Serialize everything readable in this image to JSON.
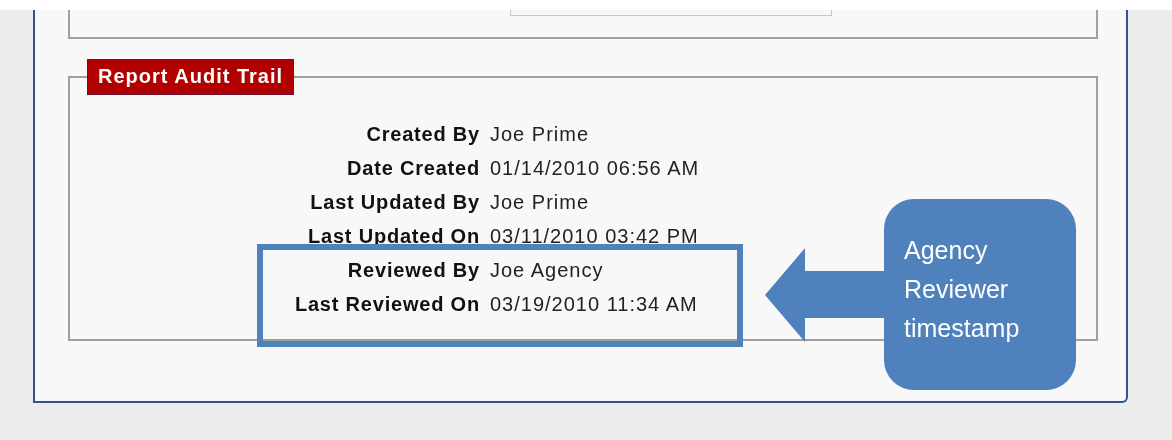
{
  "audit_trail": {
    "title": "Report Audit Trail",
    "rows": [
      {
        "label": "Created By",
        "value": "Joe Prime"
      },
      {
        "label": "Date Created",
        "value": "01/14/2010 06:56 AM"
      },
      {
        "label": "Last Updated By",
        "value": "Joe Prime"
      },
      {
        "label": "Last Updated On",
        "value": "03/11/2010 03:42 PM"
      },
      {
        "label": "Reviewed By",
        "value": "Joe Agency"
      },
      {
        "label": "Last Reviewed On",
        "value": "03/19/2010 11:34 AM"
      }
    ]
  },
  "callout": {
    "text": "Agency Reviewer timestamp"
  }
}
